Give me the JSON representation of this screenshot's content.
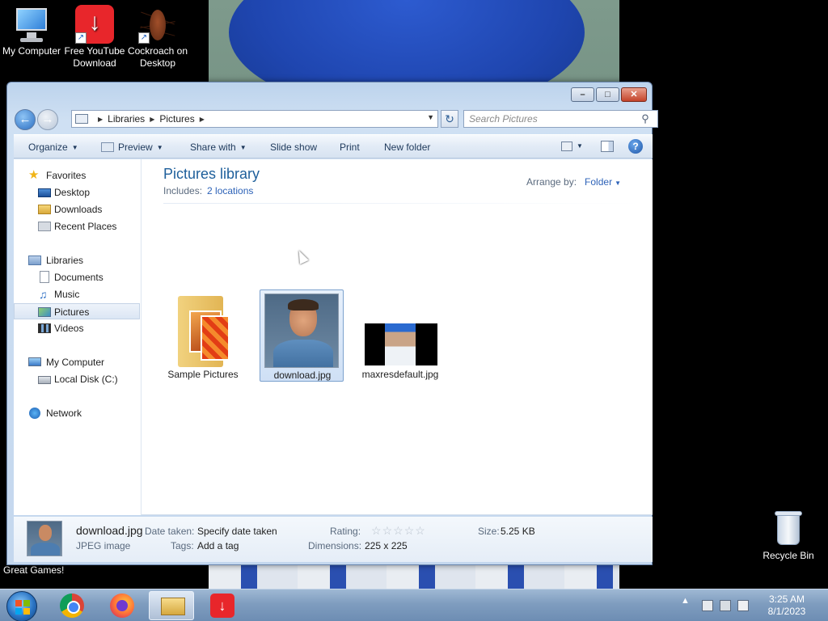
{
  "desktop": {
    "icons": [
      {
        "label": "My Computer"
      },
      {
        "label": "Free YouTube Download"
      },
      {
        "label": "Cockroach on Desktop"
      },
      {
        "label": "Recycle Bin"
      }
    ],
    "gadget_text": "Great Games!"
  },
  "window": {
    "address": {
      "crumbs": [
        "Libraries",
        "Pictures"
      ],
      "search_placeholder": "Search Pictures"
    },
    "toolbar": {
      "organize": "Organize",
      "preview": "Preview",
      "share_with": "Share with",
      "slide_show": "Slide show",
      "print": "Print",
      "new_folder": "New folder"
    },
    "nav": {
      "favorites": "Favorites",
      "desktop": "Desktop",
      "downloads": "Downloads",
      "recent_places": "Recent Places",
      "libraries": "Libraries",
      "documents": "Documents",
      "music": "Music",
      "pictures": "Pictures",
      "videos": "Videos",
      "my_computer": "My Computer",
      "local_disk": "Local Disk (C:)",
      "network": "Network"
    },
    "library": {
      "title": "Pictures library",
      "includes_label": "Includes:",
      "includes_link": "2 locations",
      "arrange_label": "Arrange by:",
      "arrange_value": "Folder"
    },
    "files": [
      {
        "name": "Sample Pictures",
        "kind": "folder"
      },
      {
        "name": "download.jpg",
        "kind": "image",
        "selected": true
      },
      {
        "name": "maxresdefault.jpg",
        "kind": "image"
      }
    ],
    "details": {
      "filename": "download.jpg",
      "filetype": "JPEG image",
      "date_taken_label": "Date taken:",
      "date_taken_value": "Specify date taken",
      "tags_label": "Tags:",
      "tags_value": "Add a tag",
      "rating_label": "Rating:",
      "rating_value": 0,
      "rating_max": 5,
      "dimensions_label": "Dimensions:",
      "dimensions_value": "225 x 225",
      "size_label": "Size:",
      "size_value": "5.25 KB"
    }
  },
  "taskbar": {
    "time": "3:25 AM",
    "date": "8/1/2023",
    "apps": [
      "Google Chrome",
      "Firefox",
      "Windows Explorer",
      "Free YouTube Download"
    ]
  },
  "colors": {
    "accent": "#1e5f9b",
    "link": "#2e63b8",
    "selection": "#cfe0f5"
  }
}
